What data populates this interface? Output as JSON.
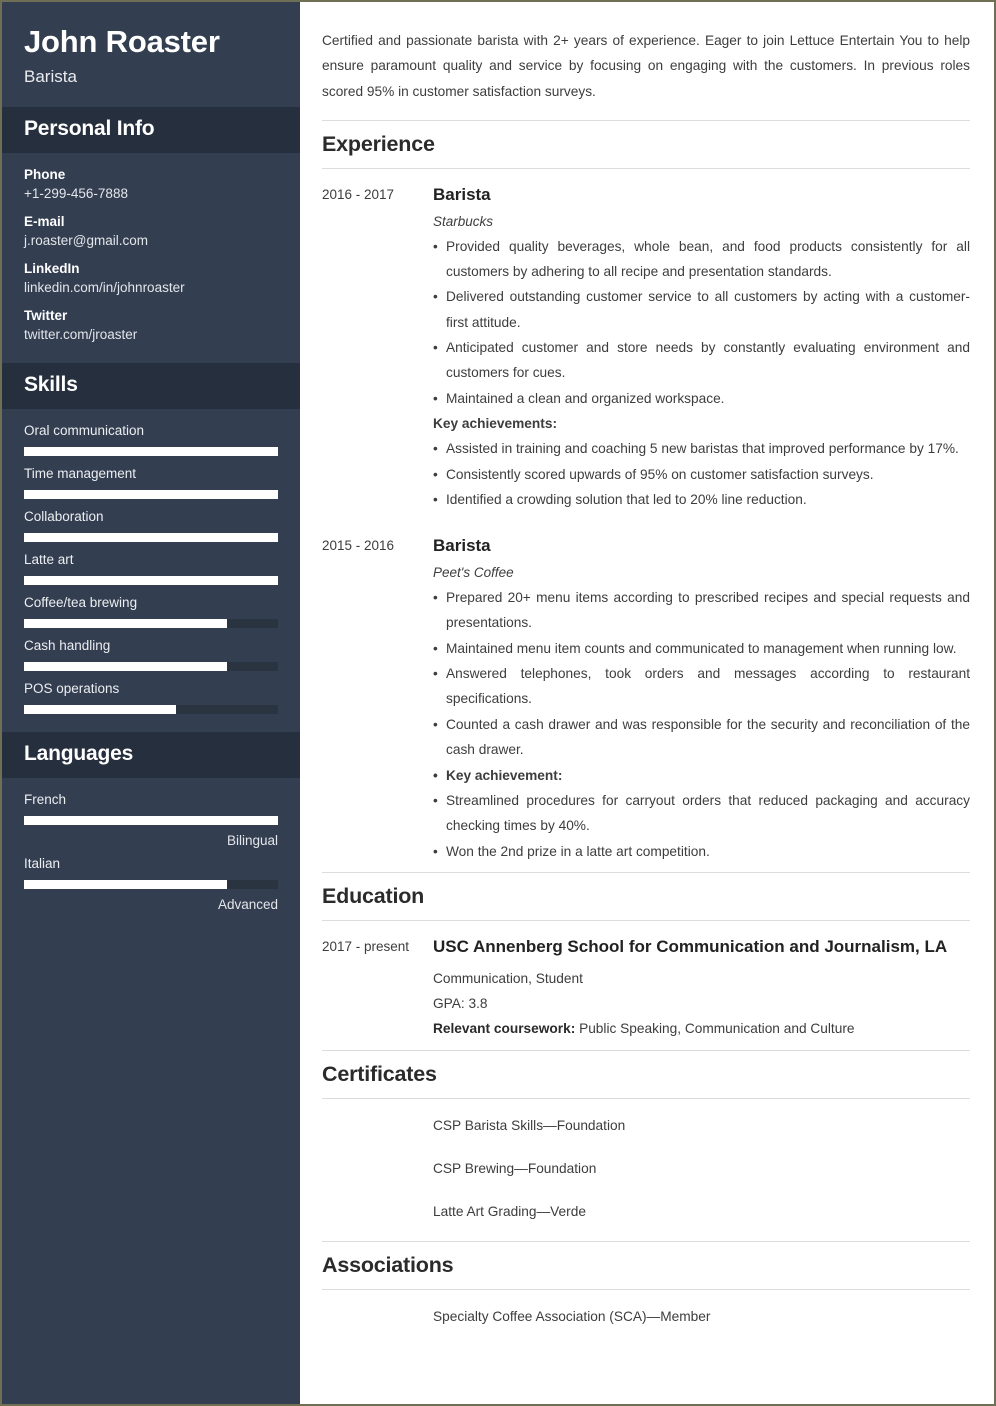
{
  "sidebar": {
    "name": "John Roaster",
    "role": "Barista",
    "personal_info": {
      "heading": "Personal Info",
      "items": [
        {
          "label": "Phone",
          "value": "+1-299-456-7888"
        },
        {
          "label": "E-mail",
          "value": "j.roaster@gmail.com"
        },
        {
          "label": "LinkedIn",
          "value": "linkedin.com/in/johnroaster"
        },
        {
          "label": "Twitter",
          "value": "twitter.com/jroaster"
        }
      ]
    },
    "skills": {
      "heading": "Skills",
      "items": [
        {
          "label": "Oral communication",
          "level": 100
        },
        {
          "label": "Time management",
          "level": 100
        },
        {
          "label": "Collaboration",
          "level": 100
        },
        {
          "label": "Latte art",
          "level": 100
        },
        {
          "label": "Coffee/tea brewing",
          "level": 80
        },
        {
          "label": "Cash handling",
          "level": 80
        },
        {
          "label": "POS operations",
          "level": 60
        }
      ]
    },
    "languages": {
      "heading": "Languages",
      "items": [
        {
          "label": "French",
          "level": 100,
          "proficiency": "Bilingual"
        },
        {
          "label": "Italian",
          "level": 80,
          "proficiency": "Advanced"
        }
      ]
    }
  },
  "main": {
    "summary": "Certified and passionate barista with 2+ years of experience. Eager to join Lettuce Entertain You to help ensure paramount quality and service by focusing on engaging with the customers. In previous roles scored 95% in customer satisfaction surveys.",
    "experience": {
      "heading": "Experience",
      "entries": [
        {
          "dates": "2016 - 2017",
          "title": "Barista",
          "company": "Starbucks",
          "bullets": [
            {
              "text": "Provided quality beverages, whole bean, and food products consistently for all customers by adhering to all recipe and presentation standards.",
              "bullet": true,
              "bold": false
            },
            {
              "text": "Delivered outstanding customer service to all customers by acting with a customer-first attitude.",
              "bullet": true,
              "bold": false
            },
            {
              "text": "Anticipated customer and store needs by constantly evaluating environment and customers for cues.",
              "bullet": true,
              "bold": false
            },
            {
              "text": "Maintained a clean and organized workspace.",
              "bullet": true,
              "bold": false
            },
            {
              "text": "Key achievements:",
              "bullet": false,
              "bold": true
            },
            {
              "text": "Assisted in training and coaching 5 new baristas that improved performance by 17%.",
              "bullet": true,
              "bold": false
            },
            {
              "text": "Consistently scored upwards of 95% on customer satisfaction surveys.",
              "bullet": true,
              "bold": false
            },
            {
              "text": "Identified a crowding solution that led to 20% line reduction.",
              "bullet": true,
              "bold": false
            }
          ]
        },
        {
          "dates": "2015 - 2016",
          "title": "Barista",
          "company": "Peet's Coffee",
          "bullets": [
            {
              "text": "Prepared 20+ menu items according to prescribed recipes and special requests and presentations.",
              "bullet": true,
              "bold": false
            },
            {
              "text": "Maintained menu item counts and communicated to management when running low.",
              "bullet": true,
              "bold": false
            },
            {
              "text": "Answered telephones, took orders and messages according to restaurant specifications.",
              "bullet": true,
              "bold": false
            },
            {
              "text": "Counted a cash drawer and was responsible for the security and reconciliation of the cash drawer.",
              "bullet": true,
              "bold": false
            },
            {
              "text": "Key achievement:",
              "bullet": true,
              "bold": true
            },
            {
              "text": "Streamlined procedures for carryout orders that reduced packaging and accuracy checking times by 40%.",
              "bullet": true,
              "bold": false
            },
            {
              "text": "Won the 2nd prize in a latte art competition.",
              "bullet": true,
              "bold": false
            }
          ]
        }
      ]
    },
    "education": {
      "heading": "Education",
      "entries": [
        {
          "dates": "2017 - present",
          "title": "USC Annenberg School for Communication and Journalism, LA",
          "major": "Communication, Student",
          "gpa": "GPA: 3.8",
          "coursework_label": "Relevant coursework:",
          "coursework_value": "Public Speaking, Communication and Culture"
        }
      ]
    },
    "certificates": {
      "heading": "Certificates",
      "items": [
        "CSP Barista Skills—Foundation",
        "CSP Brewing—Foundation",
        "Latte Art Grading—Verde"
      ]
    },
    "associations": {
      "heading": "Associations",
      "items": [
        "Specialty Coffee Association (SCA)—Member"
      ]
    }
  },
  "colors": {
    "sidebar_bg": "#333e50",
    "sidebar_band": "#262f3d",
    "bar_track": "#2a3340",
    "bar_fill": "#ffffff",
    "page_border": "#6e6f55",
    "rule": "#dcdcdc"
  }
}
